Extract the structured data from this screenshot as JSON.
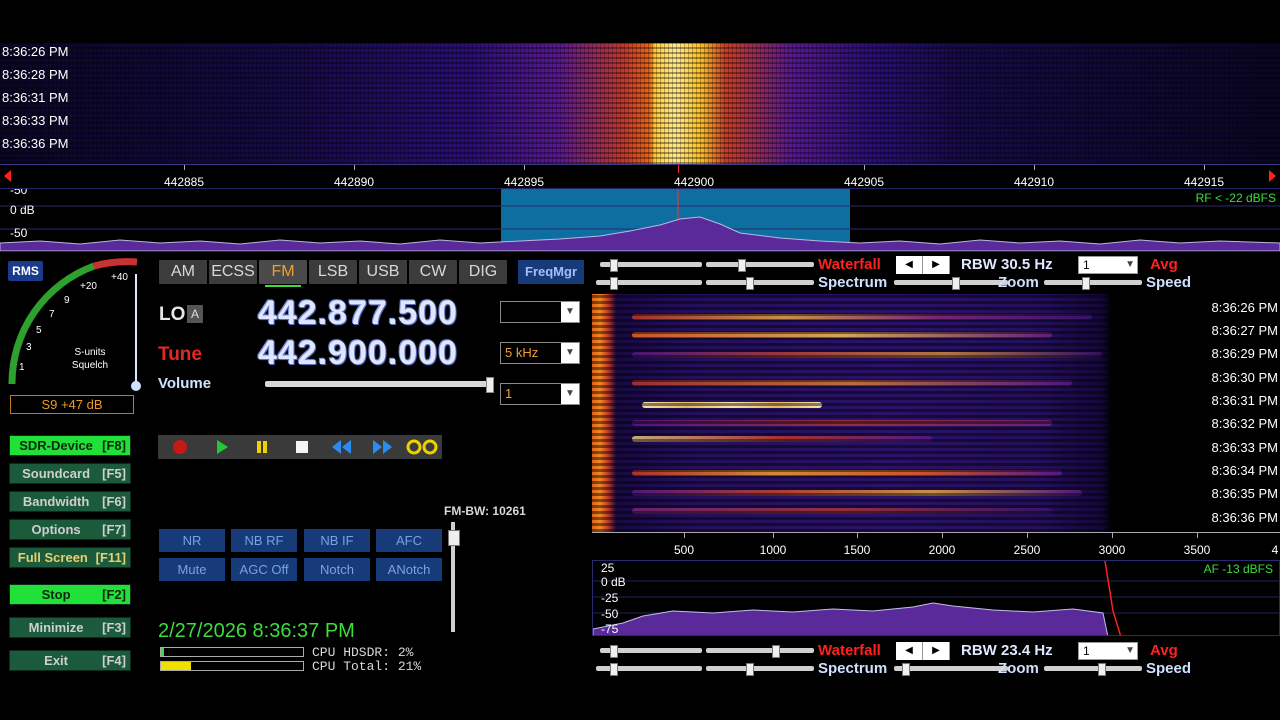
{
  "rf_waterfall": {
    "timestamps": [
      "8:36:26 PM",
      "8:36:28 PM",
      "8:36:31 PM",
      "8:36:33 PM",
      "8:36:36 PM"
    ]
  },
  "rf_scale": {
    "ticks": [
      "442885",
      "442890",
      "442895",
      "442900",
      "442905",
      "442910",
      "442915"
    ]
  },
  "rf_spectrum": {
    "db_labels": [
      "-50",
      "0 dB",
      "-50"
    ],
    "level": "RF < -22 dBFS"
  },
  "smeter": {
    "rms_label": "RMS",
    "scale": [
      "1",
      "3",
      "5",
      "7",
      "9",
      "+20",
      "+40"
    ],
    "caption_1": "S-units",
    "caption_2": "Squelch",
    "readout": "S9 +47 dB"
  },
  "side_buttons": [
    {
      "label": "SDR-Device",
      "key": "[F8]"
    },
    {
      "label": "Soundcard",
      "key": "[F5]"
    },
    {
      "label": "Bandwidth",
      "key": "[F6]"
    },
    {
      "label": "Options",
      "key": "[F7]"
    },
    {
      "label": "Full Screen",
      "key": "[F11]"
    },
    {
      "label": "Stop",
      "key": "[F2]"
    },
    {
      "label": "Minimize",
      "key": "[F3]"
    },
    {
      "label": "Exit",
      "key": "[F4]"
    }
  ],
  "modes": [
    "AM",
    "ECSS",
    "FM",
    "LSB",
    "USB",
    "CW",
    "DIG"
  ],
  "active_mode": "FM",
  "freqmgr_label": "FreqMgr",
  "lo": {
    "label": "LO",
    "badge": "A",
    "frequency": "442.877.500",
    "combo": ""
  },
  "tune": {
    "label": "Tune",
    "frequency": "442.900.000",
    "combo": "5 kHz"
  },
  "volume": {
    "label": "Volume",
    "combo": "1"
  },
  "fm_bw": "FM-BW: 10261",
  "dsp_buttons": [
    "NR",
    "NB RF",
    "NB IF",
    "AFC",
    "Mute",
    "AGC Off",
    "Notch",
    "ANotch"
  ],
  "clock": "2/27/2026 8:36:37 PM",
  "cpu": {
    "hdsdr": "CPU HDSDR:  2%",
    "total": "CPU Total: 21%",
    "hdsdr_fraction": 0.02,
    "total_fraction": 0.21
  },
  "rf_controls": {
    "waterfall": "Waterfall",
    "spectrum": "Spectrum",
    "zoom": "Zoom",
    "speed": "Speed",
    "avg": "Avg",
    "rbw": "RBW 30.5 Hz",
    "avg_value": "1"
  },
  "af_controls": {
    "waterfall": "Waterfall",
    "spectrum": "Spectrum",
    "zoom": "Zoom",
    "speed": "Speed",
    "avg": "Avg",
    "rbw": "RBW 23.4 Hz",
    "avg_value": "1"
  },
  "af_waterfall": {
    "timestamps": [
      "8:36:26 PM",
      "8:36:27 PM",
      "8:36:29 PM",
      "8:36:30 PM",
      "8:36:31 PM",
      "8:36:32 PM",
      "8:36:33 PM",
      "8:36:34 PM",
      "8:36:35 PM",
      "8:36:36 PM"
    ]
  },
  "af_scale": {
    "ticks": [
      "500",
      "1000",
      "1500",
      "2000",
      "2500",
      "3000",
      "3500",
      "4"
    ]
  },
  "af_spectrum": {
    "db_labels": [
      "25",
      "0 dB",
      "-25",
      "-50",
      "-75"
    ],
    "level": "AF -13 dBFS"
  },
  "colors": {
    "accent_green": "#3ddc3d",
    "mode_active": "#f0a030",
    "tune_red": "#e02828",
    "button_blue": "#173a78"
  }
}
